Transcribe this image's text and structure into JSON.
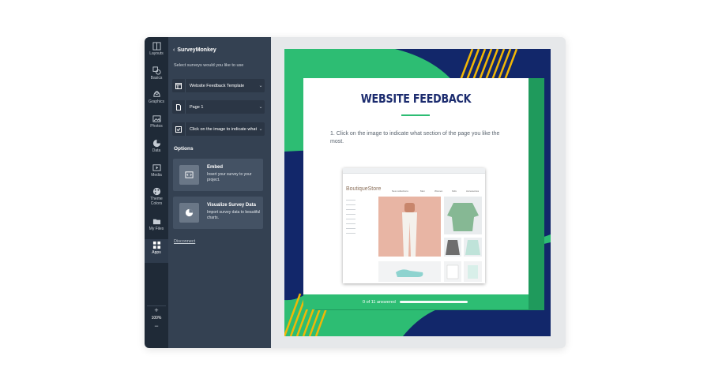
{
  "rail": {
    "items": [
      {
        "name": "layouts",
        "label": "Layouts",
        "icon": "layouts-icon"
      },
      {
        "name": "basics",
        "label": "Basics",
        "icon": "basics-icon"
      },
      {
        "name": "graphics",
        "label": "Graphics",
        "icon": "graphics-icon"
      },
      {
        "name": "photos",
        "label": "Photos",
        "icon": "photos-icon"
      },
      {
        "name": "data",
        "label": "Data",
        "icon": "data-icon"
      },
      {
        "name": "media",
        "label": "Media",
        "icon": "media-icon"
      },
      {
        "name": "theme-colors",
        "label": "Theme Colors",
        "icon": "palette-icon"
      },
      {
        "name": "my-files",
        "label": "My Files",
        "icon": "folder-icon"
      },
      {
        "name": "apps",
        "label": "Apps",
        "icon": "apps-icon"
      }
    ],
    "zoom": {
      "plus": "+",
      "level": "100%",
      "minus": "−"
    }
  },
  "panel": {
    "title": "SurveyMonkey",
    "hint": "Select surveys would you like to use",
    "survey_select": "Website Feedback Template",
    "page_select": "Page 1",
    "question_select": "Click on the image to indicate what section",
    "options_heading": "Options",
    "embed": {
      "title": "Embed",
      "desc": "Insert your survey to your project."
    },
    "visualize": {
      "title": "Visualize Survey Data",
      "desc": "Import survey data to beautiful charts."
    },
    "disconnect": "Disconnect"
  },
  "survey": {
    "title": "WEBSITE FEEDBACK",
    "question": "1. Click on the image to indicate what section of the page you like the most.",
    "progress_text": "0 of 11 answered",
    "progress_value": 0
  },
  "screenshot": {
    "brand": "BoutiqueStore",
    "nav": [
      "New collections",
      "Men",
      "Women",
      "Kids",
      "Accessories"
    ]
  },
  "colors": {
    "rail": "#1f2a37",
    "panel": "#344152",
    "green": "#2dbd73",
    "navy": "#12276a",
    "gold": "#f2b705",
    "title": "#1b2b6e"
  }
}
